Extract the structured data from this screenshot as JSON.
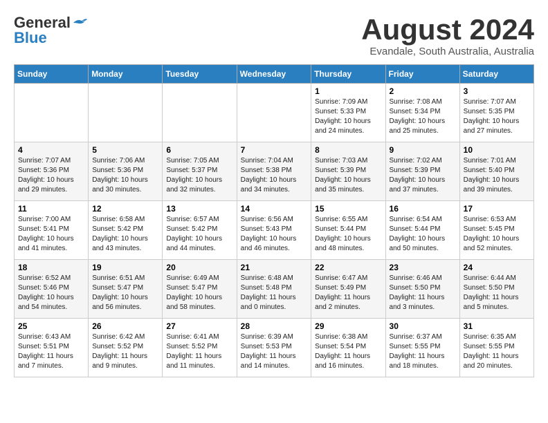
{
  "header": {
    "logo_general": "General",
    "logo_blue": "Blue",
    "month_title": "August 2024",
    "location": "Evandale, South Australia, Australia"
  },
  "weekdays": [
    "Sunday",
    "Monday",
    "Tuesday",
    "Wednesday",
    "Thursday",
    "Friday",
    "Saturday"
  ],
  "weeks": [
    [
      {
        "day": "",
        "sunrise": "",
        "sunset": "",
        "daylight": ""
      },
      {
        "day": "",
        "sunrise": "",
        "sunset": "",
        "daylight": ""
      },
      {
        "day": "",
        "sunrise": "",
        "sunset": "",
        "daylight": ""
      },
      {
        "day": "",
        "sunrise": "",
        "sunset": "",
        "daylight": ""
      },
      {
        "day": "1",
        "sunrise": "Sunrise: 7:09 AM",
        "sunset": "Sunset: 5:33 PM",
        "daylight": "Daylight: 10 hours and 24 minutes."
      },
      {
        "day": "2",
        "sunrise": "Sunrise: 7:08 AM",
        "sunset": "Sunset: 5:34 PM",
        "daylight": "Daylight: 10 hours and 25 minutes."
      },
      {
        "day": "3",
        "sunrise": "Sunrise: 7:07 AM",
        "sunset": "Sunset: 5:35 PM",
        "daylight": "Daylight: 10 hours and 27 minutes."
      }
    ],
    [
      {
        "day": "4",
        "sunrise": "Sunrise: 7:07 AM",
        "sunset": "Sunset: 5:36 PM",
        "daylight": "Daylight: 10 hours and 29 minutes."
      },
      {
        "day": "5",
        "sunrise": "Sunrise: 7:06 AM",
        "sunset": "Sunset: 5:36 PM",
        "daylight": "Daylight: 10 hours and 30 minutes."
      },
      {
        "day": "6",
        "sunrise": "Sunrise: 7:05 AM",
        "sunset": "Sunset: 5:37 PM",
        "daylight": "Daylight: 10 hours and 32 minutes."
      },
      {
        "day": "7",
        "sunrise": "Sunrise: 7:04 AM",
        "sunset": "Sunset: 5:38 PM",
        "daylight": "Daylight: 10 hours and 34 minutes."
      },
      {
        "day": "8",
        "sunrise": "Sunrise: 7:03 AM",
        "sunset": "Sunset: 5:39 PM",
        "daylight": "Daylight: 10 hours and 35 minutes."
      },
      {
        "day": "9",
        "sunrise": "Sunrise: 7:02 AM",
        "sunset": "Sunset: 5:39 PM",
        "daylight": "Daylight: 10 hours and 37 minutes."
      },
      {
        "day": "10",
        "sunrise": "Sunrise: 7:01 AM",
        "sunset": "Sunset: 5:40 PM",
        "daylight": "Daylight: 10 hours and 39 minutes."
      }
    ],
    [
      {
        "day": "11",
        "sunrise": "Sunrise: 7:00 AM",
        "sunset": "Sunset: 5:41 PM",
        "daylight": "Daylight: 10 hours and 41 minutes."
      },
      {
        "day": "12",
        "sunrise": "Sunrise: 6:58 AM",
        "sunset": "Sunset: 5:42 PM",
        "daylight": "Daylight: 10 hours and 43 minutes."
      },
      {
        "day": "13",
        "sunrise": "Sunrise: 6:57 AM",
        "sunset": "Sunset: 5:42 PM",
        "daylight": "Daylight: 10 hours and 44 minutes."
      },
      {
        "day": "14",
        "sunrise": "Sunrise: 6:56 AM",
        "sunset": "Sunset: 5:43 PM",
        "daylight": "Daylight: 10 hours and 46 minutes."
      },
      {
        "day": "15",
        "sunrise": "Sunrise: 6:55 AM",
        "sunset": "Sunset: 5:44 PM",
        "daylight": "Daylight: 10 hours and 48 minutes."
      },
      {
        "day": "16",
        "sunrise": "Sunrise: 6:54 AM",
        "sunset": "Sunset: 5:44 PM",
        "daylight": "Daylight: 10 hours and 50 minutes."
      },
      {
        "day": "17",
        "sunrise": "Sunrise: 6:53 AM",
        "sunset": "Sunset: 5:45 PM",
        "daylight": "Daylight: 10 hours and 52 minutes."
      }
    ],
    [
      {
        "day": "18",
        "sunrise": "Sunrise: 6:52 AM",
        "sunset": "Sunset: 5:46 PM",
        "daylight": "Daylight: 10 hours and 54 minutes."
      },
      {
        "day": "19",
        "sunrise": "Sunrise: 6:51 AM",
        "sunset": "Sunset: 5:47 PM",
        "daylight": "Daylight: 10 hours and 56 minutes."
      },
      {
        "day": "20",
        "sunrise": "Sunrise: 6:49 AM",
        "sunset": "Sunset: 5:47 PM",
        "daylight": "Daylight: 10 hours and 58 minutes."
      },
      {
        "day": "21",
        "sunrise": "Sunrise: 6:48 AM",
        "sunset": "Sunset: 5:48 PM",
        "daylight": "Daylight: 11 hours and 0 minutes."
      },
      {
        "day": "22",
        "sunrise": "Sunrise: 6:47 AM",
        "sunset": "Sunset: 5:49 PM",
        "daylight": "Daylight: 11 hours and 2 minutes."
      },
      {
        "day": "23",
        "sunrise": "Sunrise: 6:46 AM",
        "sunset": "Sunset: 5:50 PM",
        "daylight": "Daylight: 11 hours and 3 minutes."
      },
      {
        "day": "24",
        "sunrise": "Sunrise: 6:44 AM",
        "sunset": "Sunset: 5:50 PM",
        "daylight": "Daylight: 11 hours and 5 minutes."
      }
    ],
    [
      {
        "day": "25",
        "sunrise": "Sunrise: 6:43 AM",
        "sunset": "Sunset: 5:51 PM",
        "daylight": "Daylight: 11 hours and 7 minutes."
      },
      {
        "day": "26",
        "sunrise": "Sunrise: 6:42 AM",
        "sunset": "Sunset: 5:52 PM",
        "daylight": "Daylight: 11 hours and 9 minutes."
      },
      {
        "day": "27",
        "sunrise": "Sunrise: 6:41 AM",
        "sunset": "Sunset: 5:52 PM",
        "daylight": "Daylight: 11 hours and 11 minutes."
      },
      {
        "day": "28",
        "sunrise": "Sunrise: 6:39 AM",
        "sunset": "Sunset: 5:53 PM",
        "daylight": "Daylight: 11 hours and 14 minutes."
      },
      {
        "day": "29",
        "sunrise": "Sunrise: 6:38 AM",
        "sunset": "Sunset: 5:54 PM",
        "daylight": "Daylight: 11 hours and 16 minutes."
      },
      {
        "day": "30",
        "sunrise": "Sunrise: 6:37 AM",
        "sunset": "Sunset: 5:55 PM",
        "daylight": "Daylight: 11 hours and 18 minutes."
      },
      {
        "day": "31",
        "sunrise": "Sunrise: 6:35 AM",
        "sunset": "Sunset: 5:55 PM",
        "daylight": "Daylight: 11 hours and 20 minutes."
      }
    ]
  ]
}
